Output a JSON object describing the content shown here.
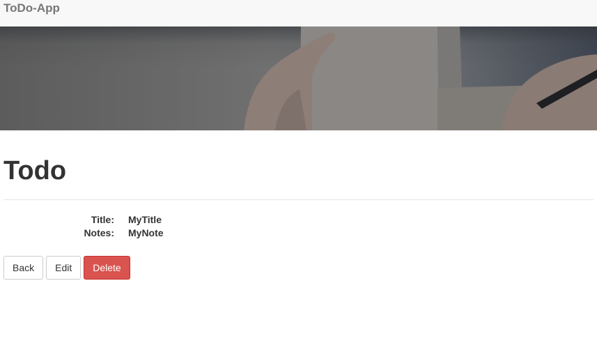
{
  "navbar": {
    "brand": "ToDo-App"
  },
  "hero": {
    "image": "notebook-writing-photo"
  },
  "page": {
    "title": "Todo"
  },
  "details": {
    "rows": [
      {
        "label": "Title:",
        "value": "MyTitle"
      },
      {
        "label": "Notes:",
        "value": "MyNote"
      }
    ]
  },
  "actions": {
    "back_label": "Back",
    "edit_label": "Edit",
    "delete_label": "Delete"
  },
  "colors": {
    "navbar_bg": "#f8f8f8",
    "brand": "#777777",
    "danger": "#d9534f"
  }
}
